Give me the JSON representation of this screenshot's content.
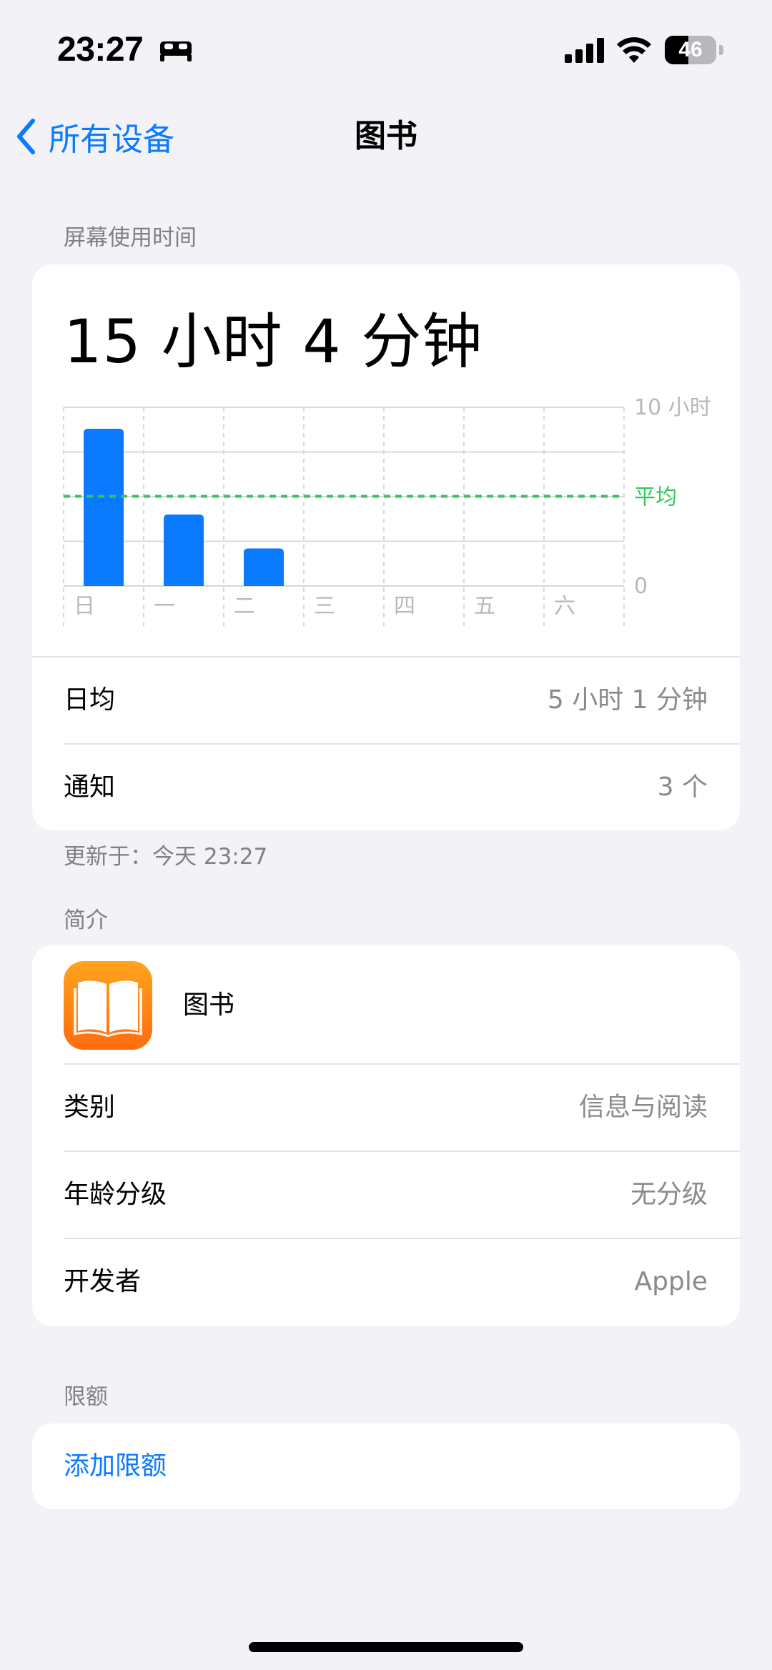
{
  "status_bar": {
    "time": "23:27",
    "battery": "46",
    "battery_level": 0.46
  },
  "nav": {
    "back_label": "所有设备",
    "title": "图书"
  },
  "screen_time": {
    "section_header": "屏幕使用时间",
    "total": "15 小时 4 分钟",
    "daily_average_label": "日均",
    "daily_average_value": "5 小时 1 分钟",
    "notifications_label": "通知",
    "notifications_value": "3 个",
    "updated": "更新于：今天 23:27"
  },
  "chart_data": {
    "type": "bar",
    "categories": [
      "日",
      "一",
      "二",
      "三",
      "四",
      "五",
      "六"
    ],
    "values": [
      8.8,
      4.0,
      2.1,
      0,
      0,
      0,
      0
    ],
    "ylim": [
      0,
      10
    ],
    "y_tick_labels": [
      "10 小时",
      "0"
    ],
    "average_label": "平均",
    "average_value": 5.02,
    "bar_color": "#0A7AFF",
    "average_color": "#34C759",
    "grid": true
  },
  "about": {
    "section_header": "简介",
    "app_name": "图书",
    "category_label": "类别",
    "category_value": "信息与阅读",
    "age_rating_label": "年龄分级",
    "age_rating_value": "无分级",
    "developer_label": "开发者",
    "developer_value": "Apple",
    "app_icon": "books-icon"
  },
  "limits": {
    "section_header": "限额",
    "add_limit_label": "添加限额"
  }
}
